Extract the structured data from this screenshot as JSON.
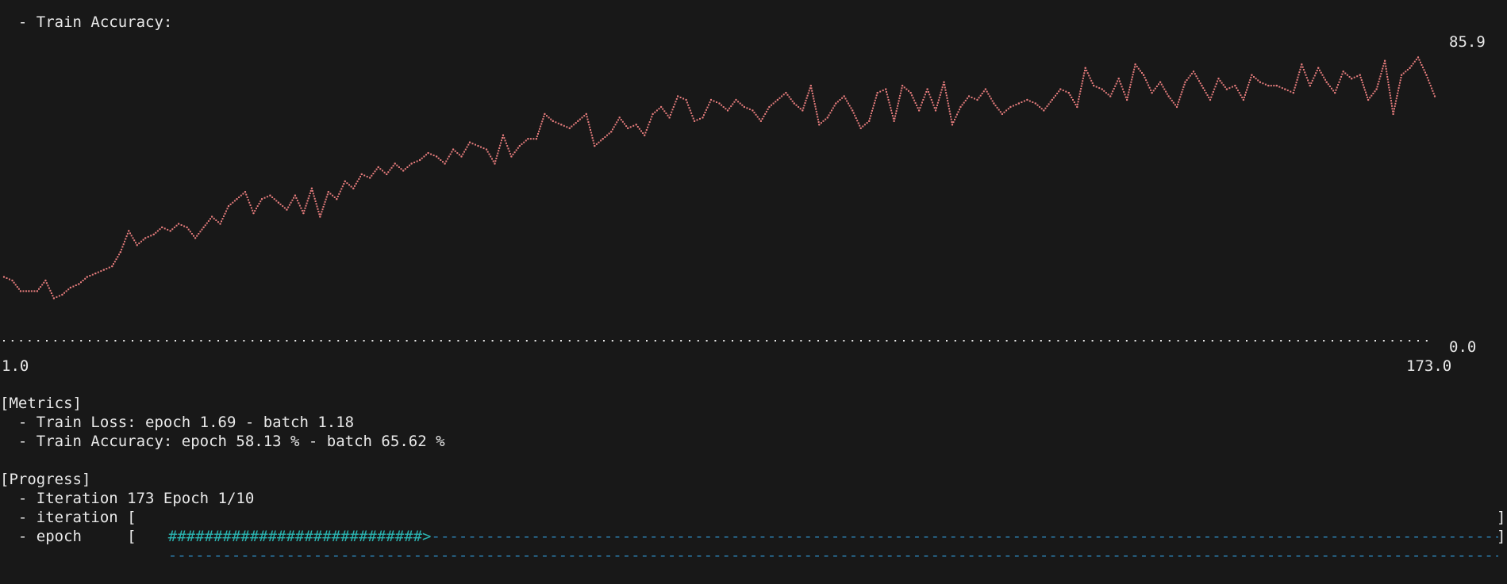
{
  "colors": {
    "background": "#181818",
    "text": "#e8e8e8",
    "plot_line": "#e57c7c",
    "plot_axis": "#e8e8e8",
    "progress_filled": "#2ab3b0",
    "progress_empty": "#2b7fb0"
  },
  "chart": {
    "heading": "  - Train Accuracy:",
    "y_max_label": "85.9",
    "y_min_label": "0.0",
    "x_min_label": "1.0",
    "x_max_label": "173.0"
  },
  "chart_data": {
    "type": "line",
    "title": "Train Accuracy",
    "xlabel": "",
    "ylabel": "",
    "xlim": [
      1,
      173
    ],
    "ylim": [
      0,
      85.9
    ],
    "grid": false,
    "series": [
      {
        "name": "",
        "x": [
          1,
          2,
          3,
          4,
          5,
          6,
          7,
          8,
          9,
          10,
          11,
          12,
          13,
          14,
          15,
          16,
          17,
          18,
          19,
          20,
          21,
          22,
          23,
          24,
          25,
          26,
          27,
          28,
          29,
          30,
          31,
          32,
          33,
          34,
          35,
          36,
          37,
          38,
          39,
          40,
          41,
          42,
          43,
          44,
          45,
          46,
          47,
          48,
          49,
          50,
          51,
          52,
          53,
          54,
          55,
          56,
          57,
          58,
          59,
          60,
          61,
          62,
          63,
          64,
          65,
          66,
          67,
          68,
          69,
          70,
          71,
          72,
          73,
          74,
          75,
          76,
          77,
          78,
          79,
          80,
          81,
          82,
          83,
          84,
          85,
          86,
          87,
          88,
          89,
          90,
          91,
          92,
          93,
          94,
          95,
          96,
          97,
          98,
          99,
          100,
          101,
          102,
          103,
          104,
          105,
          106,
          107,
          108,
          109,
          110,
          111,
          112,
          113,
          114,
          115,
          116,
          117,
          118,
          119,
          120,
          121,
          122,
          123,
          124,
          125,
          126,
          127,
          128,
          129,
          130,
          131,
          132,
          133,
          134,
          135,
          136,
          137,
          138,
          139,
          140,
          141,
          142,
          143,
          144,
          145,
          146,
          147,
          148,
          149,
          150,
          151,
          152,
          153,
          154,
          155,
          156,
          157,
          158,
          159,
          160,
          161,
          162,
          163,
          164,
          165,
          166,
          167,
          168,
          169,
          170,
          171,
          172,
          173
        ],
        "values": [
          18,
          17,
          14,
          14,
          14,
          17,
          12,
          13,
          15,
          16,
          18,
          19,
          20,
          21,
          25,
          31,
          27,
          29,
          30,
          32,
          31,
          33,
          32,
          29,
          32,
          35,
          33,
          38,
          40,
          42,
          36,
          40,
          41,
          39,
          37,
          41,
          36,
          43,
          35,
          42,
          40,
          45,
          43,
          47,
          46,
          49,
          47,
          50,
          48,
          50,
          51,
          53,
          52,
          50,
          54,
          52,
          56,
          55,
          54,
          50,
          58,
          52,
          55,
          57,
          57,
          64,
          62,
          61,
          60,
          62,
          64,
          55,
          57,
          59,
          63,
          60,
          61,
          58,
          64,
          66,
          63,
          69,
          68,
          62,
          63,
          68,
          67,
          65,
          68,
          66,
          65,
          62,
          66,
          68,
          70,
          67,
          65,
          72,
          61,
          63,
          67,
          69,
          65,
          60,
          62,
          70,
          71,
          62,
          72,
          70,
          65,
          71,
          65,
          73,
          61,
          66,
          69,
          68,
          71,
          67,
          64,
          66,
          67,
          68,
          67,
          65,
          68,
          71,
          70,
          66,
          77,
          72,
          71,
          69,
          74,
          68,
          78,
          75,
          70,
          73,
          69,
          66,
          73,
          76,
          72,
          68,
          74,
          71,
          72,
          68,
          75,
          73,
          72,
          72,
          71,
          70,
          78,
          72,
          77,
          73,
          70,
          76,
          74,
          75,
          68,
          71,
          79,
          64,
          75,
          77,
          80,
          75,
          69
        ]
      }
    ]
  },
  "metrics": {
    "header": "[Metrics]",
    "train_loss": "  - Train Loss: epoch 1.69 - batch 1.18",
    "train_accuracy": "  - Train Accuracy: epoch 58.13 % - batch 65.62 %"
  },
  "progress": {
    "header": "[Progress]",
    "iteration_line": "  - Iteration 173 Epoch 1/10",
    "iteration_label": "  - iteration [",
    "iteration_fill": "############################>",
    "iteration_fraction": 0.173,
    "epoch_label": "  - epoch     [",
    "epoch_fraction": 0.0,
    "bar_end": "]"
  }
}
